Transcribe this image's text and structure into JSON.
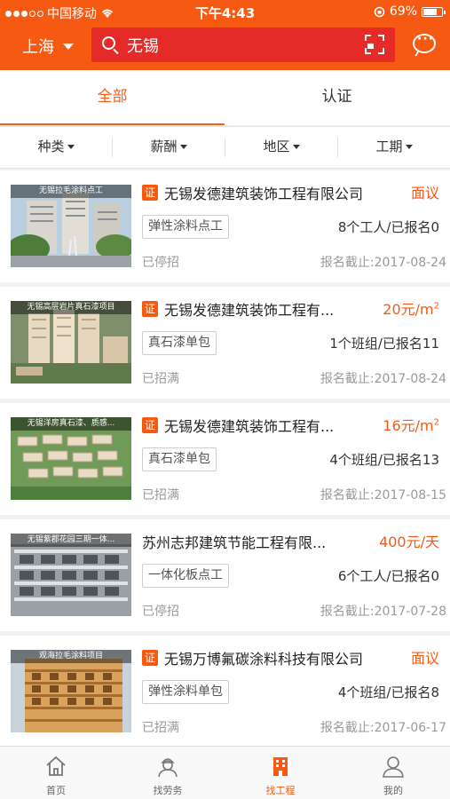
{
  "status_bar": {
    "carrier": "中国移动",
    "time": "下午4:43",
    "battery": "69%"
  },
  "header": {
    "city": "上海",
    "search_value": "无锡"
  },
  "tabs": [
    {
      "label": "全部",
      "active": true
    },
    {
      "label": "认证",
      "active": false
    }
  ],
  "filters": [
    "种类",
    "薪酬",
    "地区",
    "工期"
  ],
  "listings": [
    {
      "image_caption": "无锡拉毛涂料点工",
      "certified": true,
      "cert_label": "证",
      "company": "无锡发德建筑装饰工程有限公司",
      "price": "面议",
      "price_sup": "",
      "tag": "弹性涂料点工",
      "count": "8个工人/已报名0",
      "status": "已停招",
      "deadline": "报名截止:2017-08-24"
    },
    {
      "image_caption": "无锡高层岩片真石漆项目",
      "certified": true,
      "cert_label": "证",
      "company": "无锡发德建筑装饰工程有...",
      "price": "20元/m",
      "price_sup": "2",
      "tag": "真石漆单包",
      "count": "1个班组/已报名11",
      "status": "已招满",
      "deadline": "报名截止:2017-08-24"
    },
    {
      "image_caption": "无锡洋房真石漆、质感...",
      "certified": true,
      "cert_label": "证",
      "company": "无锡发德建筑装饰工程有...",
      "price": "16元/m",
      "price_sup": "2",
      "tag": "真石漆单包",
      "count": "4个班组/已报名13",
      "status": "已招满",
      "deadline": "报名截止:2017-08-15"
    },
    {
      "image_caption": "无锡紫郡花园三期一体...",
      "certified": false,
      "cert_label": "",
      "company": "苏州志邦建筑节能工程有限...",
      "price": "400元/天",
      "price_sup": "",
      "tag": "一体化板点工",
      "count": "6个工人/已报名0",
      "status": "已停招",
      "deadline": "报名截止:2017-07-28"
    },
    {
      "image_caption": "观海拉毛涂料项目",
      "certified": true,
      "cert_label": "证",
      "company": "无锡万博氟碳涂料科技有限公司",
      "price": "面议",
      "price_sup": "",
      "tag": "弹性涂料单包",
      "count": "4个班组/已报名8",
      "status": "已招满",
      "deadline": "报名截止:2017-06-17"
    }
  ],
  "tabbar": [
    {
      "label": "首页",
      "icon": "home-icon",
      "active": false
    },
    {
      "label": "找劳务",
      "icon": "worker-icon",
      "active": false
    },
    {
      "label": "找工程",
      "icon": "building-icon",
      "active": true
    },
    {
      "label": "我的",
      "icon": "person-icon",
      "active": false
    }
  ],
  "colors": {
    "accent": "#f65a12",
    "search_bg": "#e42b28"
  }
}
